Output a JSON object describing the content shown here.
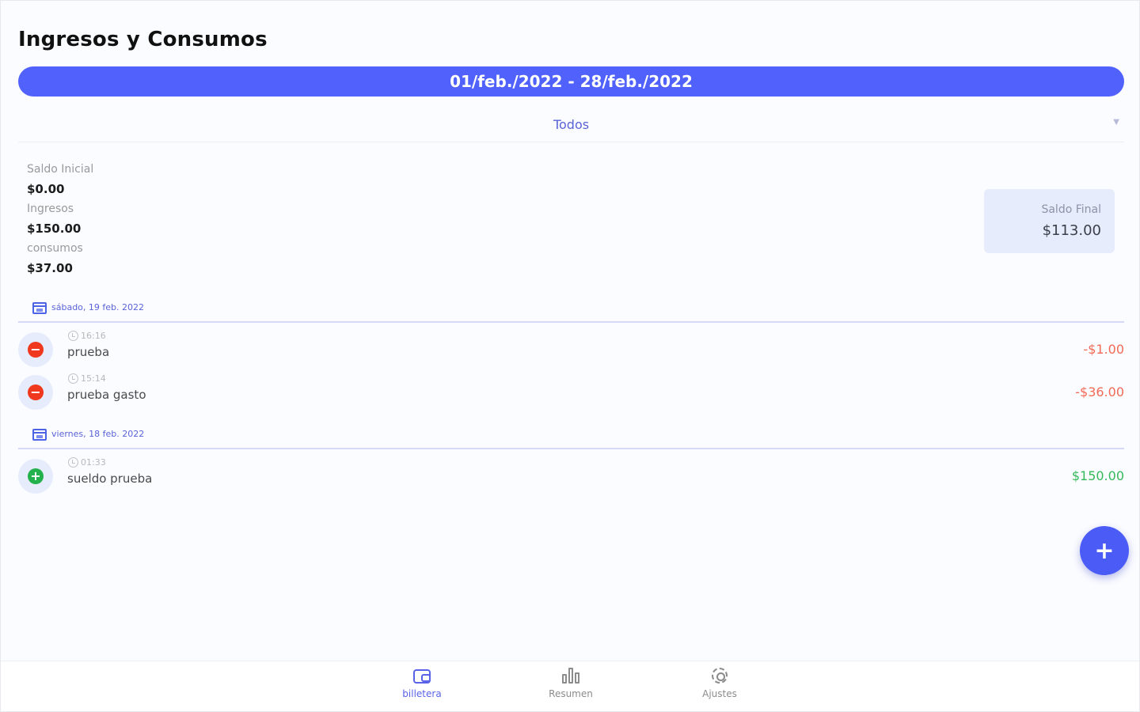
{
  "header": {
    "title": "Ingresos y Consumos"
  },
  "date_range": "01/feb./2022 - 28/feb./2022",
  "filter": {
    "selected": "Todos"
  },
  "summary": {
    "initial_label": "Saldo Inicial",
    "initial_value": "$0.00",
    "income_label": "Ingresos",
    "income_value": "$150.00",
    "consumption_label": "consumos",
    "consumption_value": "$37.00",
    "final_label": "Saldo Final",
    "final_value": "$113.00"
  },
  "days": [
    {
      "date": "sábado, 19 feb. 2022",
      "transactions": [
        {
          "time": "16:16",
          "name": "prueba",
          "amount": "-$1.00",
          "type": "expense"
        },
        {
          "time": "15:14",
          "name": "prueba gasto",
          "amount": "-$36.00",
          "type": "expense"
        }
      ]
    },
    {
      "date": "viernes, 18 feb. 2022",
      "transactions": [
        {
          "time": "01:33",
          "name": "sueldo prueba",
          "amount": "$150.00",
          "type": "income"
        }
      ]
    }
  ],
  "fab": {
    "label": "+"
  },
  "bottom_nav": [
    {
      "label": "billetera",
      "icon": "wallet-icon",
      "active": true
    },
    {
      "label": "Resumen",
      "icon": "chart-icon",
      "active": false
    },
    {
      "label": "Ajustes",
      "icon": "gear-icon",
      "active": false
    }
  ],
  "colors": {
    "accent": "#5062fb",
    "expense": "#f0381e",
    "income": "#22b14c",
    "card_bg": "#e6ecfb"
  }
}
